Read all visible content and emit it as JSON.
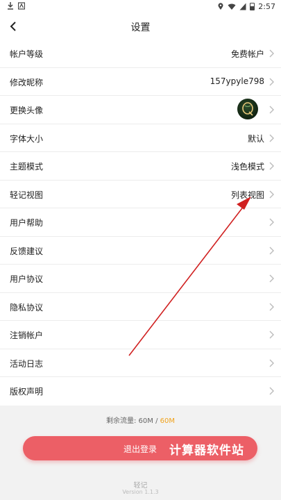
{
  "status_bar": {
    "time": "2:57"
  },
  "header": {
    "title": "设置"
  },
  "settings": [
    {
      "label": "帐户等级",
      "value": "免费帐户"
    },
    {
      "label": "修改昵称",
      "value": "157ypyle798"
    },
    {
      "label": "更换头像",
      "value": ""
    },
    {
      "label": "字体大小",
      "value": "默认"
    },
    {
      "label": "主题模式",
      "value": "浅色模式"
    },
    {
      "label": "轻记视图",
      "value": "列表视图"
    },
    {
      "label": "用户帮助",
      "value": ""
    },
    {
      "label": "反馈建议",
      "value": ""
    },
    {
      "label": "用户协议",
      "value": ""
    },
    {
      "label": "隐私协议",
      "value": ""
    },
    {
      "label": "注销帐户",
      "value": ""
    },
    {
      "label": "活动日志",
      "value": ""
    },
    {
      "label": "版权声明",
      "value": ""
    }
  ],
  "quota": {
    "prefix": "剩余流量:",
    "used": "60M",
    "sep": " / ",
    "total": "60M"
  },
  "logout_label": "退出登录",
  "watermark": "计算器软件站",
  "footer": {
    "app_name": "轻记",
    "version": "Version 1.1.3"
  },
  "colors": {
    "accent": "#ec5f66",
    "highlight": "#f0a21b",
    "annotation": "#d02020"
  }
}
